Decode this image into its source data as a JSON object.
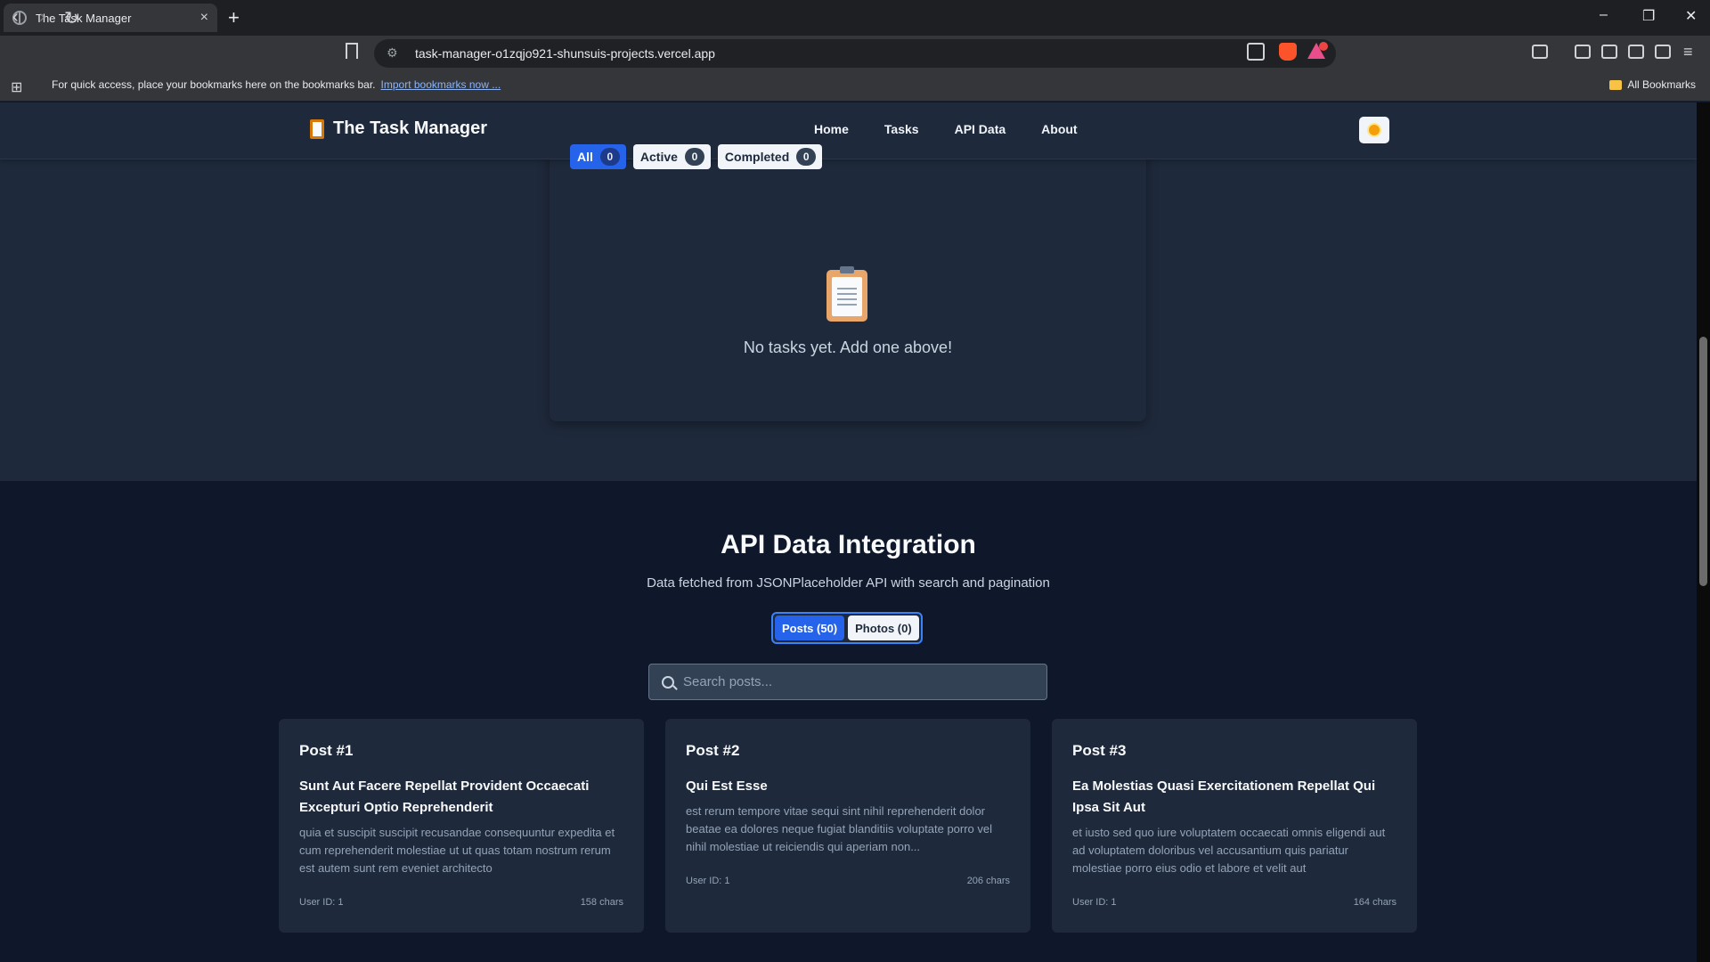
{
  "browser": {
    "tab_title": "The Task Manager",
    "url": "task-manager-o1zqjo921-shunsuis-projects.vercel.app",
    "bookmarks_hint": "For quick access, place your bookmarks here on the bookmarks bar.",
    "import_link": "Import bookmarks now ...",
    "all_bookmarks": "All Bookmarks",
    "icons": [
      "back-arrow-icon",
      "forward-arrow-icon",
      "reload-icon",
      "bookmark-icon",
      "share-icon",
      "brave-shield-icon",
      "rewards-icon"
    ]
  },
  "app": {
    "brand": "The Task Manager",
    "nav": [
      "Home",
      "Tasks",
      "API Data",
      "About"
    ],
    "theme_icon": "sun-icon"
  },
  "tasks": {
    "filters": [
      {
        "label": "All",
        "count": "0"
      },
      {
        "label": "Active",
        "count": "0"
      },
      {
        "label": "Completed",
        "count": "0"
      }
    ],
    "empty_message": "No tasks yet. Add one above!"
  },
  "api": {
    "title": "API Data Integration",
    "subtitle": "Data fetched from JSONPlaceholder API with search and pagination",
    "tabs": [
      "Posts (50)",
      "Photos (0)"
    ],
    "search_placeholder": "Search posts...",
    "posts": [
      {
        "num": "Post #1",
        "title": "Sunt Aut Facere Repellat Provident Occaecati Excepturi Optio Reprehenderit",
        "body": "quia et suscipit suscipit recusandae consequuntur expedita et cum reprehenderit molestiae ut ut quas totam nostrum rerum est autem sunt rem eveniet architecto",
        "user": "User ID: 1",
        "chars": "158 chars"
      },
      {
        "num": "Post #2",
        "title": "Qui Est Esse",
        "body": "est rerum tempore vitae sequi sint nihil reprehenderit dolor beatae ea dolores neque fugiat blanditiis voluptate porro vel nihil molestiae ut reiciendis qui aperiam non...",
        "user": "User ID: 1",
        "chars": "206 chars"
      },
      {
        "num": "Post #3",
        "title": "Ea Molestias Quasi Exercitationem Repellat Qui Ipsa Sit Aut",
        "body": "et iusto sed quo iure voluptatem occaecati omnis eligendi aut ad voluptatem doloribus vel accusantium quis pariatur molestiae porro eius odio et labore et velit aut",
        "user": "User ID: 1",
        "chars": "164 chars"
      }
    ]
  }
}
